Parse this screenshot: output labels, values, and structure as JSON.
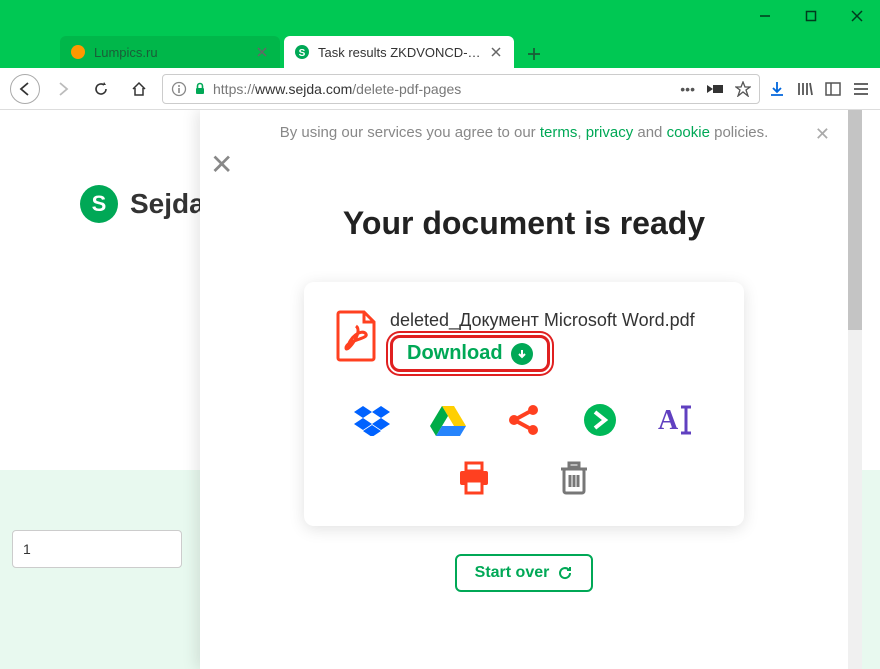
{
  "window": {
    "tabs": [
      {
        "label": "Lumpics.ru",
        "active": false
      },
      {
        "label": "Task results ZKDVONCD-20180…",
        "active": true
      }
    ]
  },
  "url": {
    "prefix": "https://",
    "host": "www.sejda.com",
    "path": "/delete-pdf-pages"
  },
  "cookie": {
    "text_before": "By using our services you agree to our ",
    "terms": "terms",
    "sep1": ", ",
    "privacy": "privacy",
    "sep2": " and ",
    "cookie": "cookie",
    "text_after": " policies."
  },
  "logo": {
    "letter": "S",
    "name": "Sejda"
  },
  "modal": {
    "title": "Your document is ready",
    "filename": "deleted_Документ Microsoft Word.pdf",
    "download_label": "Download",
    "start_over": "Start over"
  },
  "page_number": "1"
}
